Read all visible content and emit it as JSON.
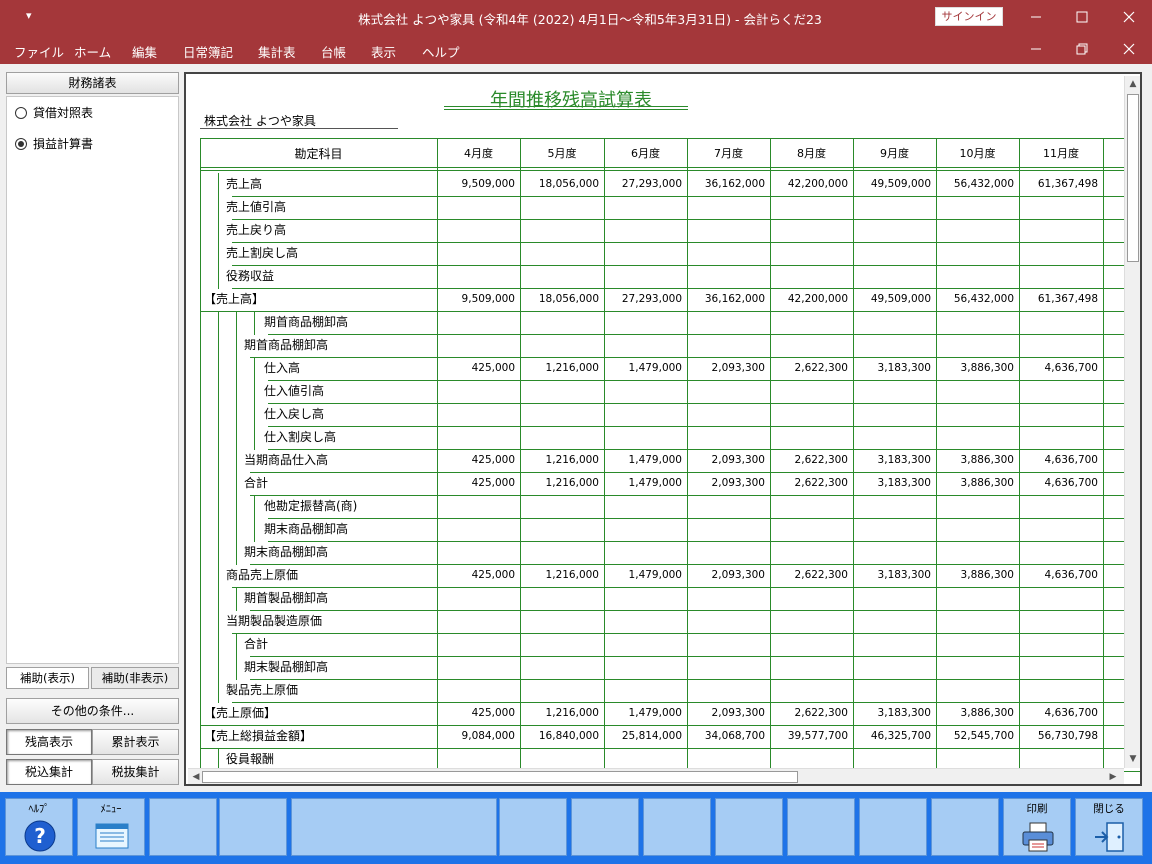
{
  "window": {
    "title": "株式会社 よつや家具 (令和4年 (2022) 4月1日～令和5年3月31日) - 会計らくだ23",
    "quick_access": "▾",
    "signin": "サインイン"
  },
  "menu": [
    "ファイル",
    "ホーム",
    "編集",
    "日常簿記",
    "集計表",
    "台帳",
    "表示",
    "ヘルプ"
  ],
  "left_panel": {
    "header": "財務諸表",
    "options": [
      {
        "label": "貸借対照表",
        "selected": false
      },
      {
        "label": "損益計算書",
        "selected": true
      }
    ],
    "tabs": [
      "補助(表示)",
      "補助(非表示)"
    ],
    "other_conditions": "その他の条件...",
    "buttons": [
      "残高表示",
      "累計表示",
      "税込集計",
      "税抜集計"
    ]
  },
  "report": {
    "title": "年間推移残高試算表",
    "company": "株式会社 よつや家具",
    "account_header": "勘定科目",
    "months": [
      "4月度",
      "5月度",
      "6月度",
      "7月度",
      "8月度",
      "9月度",
      "10月度",
      "11月度"
    ],
    "rows": [
      {
        "label": "売上高",
        "level": 1,
        "values": [
          "9,509,000",
          "18,056,000",
          "27,293,000",
          "36,162,000",
          "42,200,000",
          "49,509,000",
          "56,432,000",
          "61,367,498"
        ]
      },
      {
        "label": "売上値引高",
        "level": 1,
        "values": [
          "",
          "",
          "",
          "",
          "",
          "",
          "",
          ""
        ]
      },
      {
        "label": "売上戻り高",
        "level": 1,
        "values": [
          "",
          "",
          "",
          "",
          "",
          "",
          "",
          ""
        ]
      },
      {
        "label": "売上割戻し高",
        "level": 1,
        "values": [
          "",
          "",
          "",
          "",
          "",
          "",
          "",
          ""
        ]
      },
      {
        "label": "役務収益",
        "level": 1,
        "values": [
          "",
          "",
          "",
          "",
          "",
          "",
          "",
          ""
        ]
      },
      {
        "label": "【売上高】",
        "level": 0,
        "values": [
          "9,509,000",
          "18,056,000",
          "27,293,000",
          "36,162,000",
          "42,200,000",
          "49,509,000",
          "56,432,000",
          "61,367,498"
        ]
      },
      {
        "label": "期首商品棚卸高",
        "level": 3,
        "values": [
          "",
          "",
          "",
          "",
          "",
          "",
          "",
          ""
        ]
      },
      {
        "label": "期首商品棚卸高",
        "level": 2,
        "values": [
          "",
          "",
          "",
          "",
          "",
          "",
          "",
          ""
        ]
      },
      {
        "label": "仕入高",
        "level": 3,
        "values": [
          "425,000",
          "1,216,000",
          "1,479,000",
          "2,093,300",
          "2,622,300",
          "3,183,300",
          "3,886,300",
          "4,636,700"
        ]
      },
      {
        "label": "仕入値引高",
        "level": 3,
        "values": [
          "",
          "",
          "",
          "",
          "",
          "",
          "",
          ""
        ]
      },
      {
        "label": "仕入戻し高",
        "level": 3,
        "values": [
          "",
          "",
          "",
          "",
          "",
          "",
          "",
          ""
        ]
      },
      {
        "label": "仕入割戻し高",
        "level": 3,
        "values": [
          "",
          "",
          "",
          "",
          "",
          "",
          "",
          ""
        ]
      },
      {
        "label": "当期商品仕入高",
        "level": 2,
        "values": [
          "425,000",
          "1,216,000",
          "1,479,000",
          "2,093,300",
          "2,622,300",
          "3,183,300",
          "3,886,300",
          "4,636,700"
        ]
      },
      {
        "label": "合計",
        "level": 2,
        "values": [
          "425,000",
          "1,216,000",
          "1,479,000",
          "2,093,300",
          "2,622,300",
          "3,183,300",
          "3,886,300",
          "4,636,700"
        ]
      },
      {
        "label": "他勘定振替高(商)",
        "level": 3,
        "values": [
          "",
          "",
          "",
          "",
          "",
          "",
          "",
          ""
        ]
      },
      {
        "label": "期末商品棚卸高",
        "level": 3,
        "values": [
          "",
          "",
          "",
          "",
          "",
          "",
          "",
          ""
        ]
      },
      {
        "label": "期末商品棚卸高",
        "level": 2,
        "values": [
          "",
          "",
          "",
          "",
          "",
          "",
          "",
          ""
        ]
      },
      {
        "label": "商品売上原価",
        "level": 1,
        "values": [
          "425,000",
          "1,216,000",
          "1,479,000",
          "2,093,300",
          "2,622,300",
          "3,183,300",
          "3,886,300",
          "4,636,700"
        ]
      },
      {
        "label": "期首製品棚卸高",
        "level": 2,
        "values": [
          "",
          "",
          "",
          "",
          "",
          "",
          "",
          ""
        ]
      },
      {
        "label": "当期製品製造原価",
        "level": 1,
        "values": [
          "",
          "",
          "",
          "",
          "",
          "",
          "",
          ""
        ]
      },
      {
        "label": "合計",
        "level": 2,
        "values": [
          "",
          "",
          "",
          "",
          "",
          "",
          "",
          ""
        ]
      },
      {
        "label": "期末製品棚卸高",
        "level": 2,
        "values": [
          "",
          "",
          "",
          "",
          "",
          "",
          "",
          ""
        ]
      },
      {
        "label": "製品売上原価",
        "level": 1,
        "values": [
          "",
          "",
          "",
          "",
          "",
          "",
          "",
          ""
        ]
      },
      {
        "label": "【売上原価】",
        "level": 0,
        "values": [
          "425,000",
          "1,216,000",
          "1,479,000",
          "2,093,300",
          "2,622,300",
          "3,183,300",
          "3,886,300",
          "4,636,700"
        ]
      },
      {
        "label": "【売上総損益金額】",
        "level": 0,
        "values": [
          "9,084,000",
          "16,840,000",
          "25,814,000",
          "34,068,700",
          "39,577,700",
          "46,325,700",
          "52,545,700",
          "56,730,798"
        ]
      },
      {
        "label": "役員報酬",
        "level": 1,
        "values": [
          "",
          "",
          "",
          "",
          "",
          "",
          "",
          ""
        ]
      }
    ]
  },
  "fkeys": [
    {
      "label": "ﾍﾙﾌﾟ",
      "icon": "help-icon"
    },
    {
      "label": "ﾒﾆｭｰ",
      "icon": "menu-icon"
    },
    {
      "label": "",
      "icon": ""
    },
    {
      "label": "",
      "icon": ""
    },
    {
      "label": "",
      "icon": ""
    },
    {
      "label": "",
      "icon": ""
    },
    {
      "label": "",
      "icon": ""
    },
    {
      "label": "",
      "icon": ""
    },
    {
      "label": "",
      "icon": ""
    },
    {
      "label": "",
      "icon": ""
    },
    {
      "label": "",
      "icon": ""
    },
    {
      "label": "",
      "icon": ""
    },
    {
      "label": "印刷",
      "icon": "printer-icon"
    },
    {
      "label": "閉じる",
      "icon": "exit-door-icon"
    }
  ],
  "colors": {
    "titlebar": "#a4373a",
    "report_green": "#2a8a2a",
    "fkey_bar": "#1e73e8",
    "fkey_button": "#a6ccf4"
  }
}
